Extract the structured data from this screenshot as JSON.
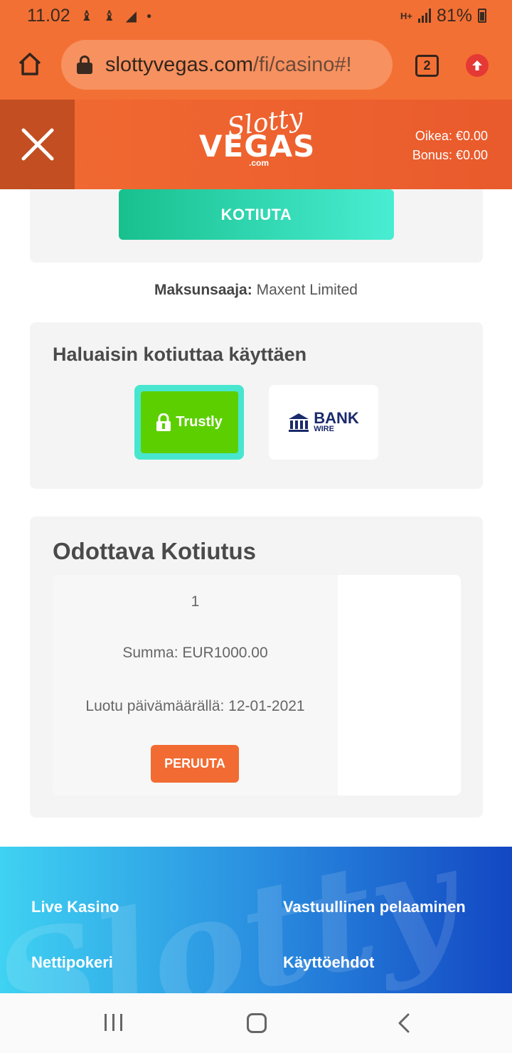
{
  "status_bar": {
    "time": "11.02",
    "network": "H+",
    "battery": "81%"
  },
  "browser": {
    "url_host": "slottyvegas.com",
    "url_path": "/fi/casino#!",
    "tab_count": "2"
  },
  "header": {
    "logo_slotty": "Slotty",
    "logo_vegas": "VEGAS",
    "logo_com": ".com",
    "real_balance": "Oikea: €0.00",
    "bonus_balance": "Bonus: €0.00"
  },
  "withdraw": {
    "button_label": "KOTIUTA"
  },
  "payee": {
    "label": "Maksunsaaja:",
    "value": "Maxent Limited"
  },
  "methods": {
    "title": "Haluaisin kotiuttaa käyttäen",
    "items": [
      {
        "label": "Trustly",
        "selected": true
      },
      {
        "label_main": "BANK",
        "label_sub": "WIRE",
        "selected": false
      }
    ]
  },
  "pending": {
    "title": "Odottava Kotiutus",
    "number": "1",
    "amount": "Summa: EUR1000.00",
    "created": "Luotu päivämäärällä: 12-01-2021",
    "cancel_label": "PERUUTA"
  },
  "footer": {
    "watermark": "Slotty",
    "links": [
      "Live Kasino",
      "Vastuullinen pelaaminen",
      "Nettipokeri",
      "Käyttöehdot"
    ]
  },
  "colors": {
    "brand_orange": "#f37034",
    "header_orange": "#e95a2c",
    "withdraw_teal": "#18c08e",
    "trustly_green": "#5ccf00",
    "footer_blue": "#1347c3"
  }
}
